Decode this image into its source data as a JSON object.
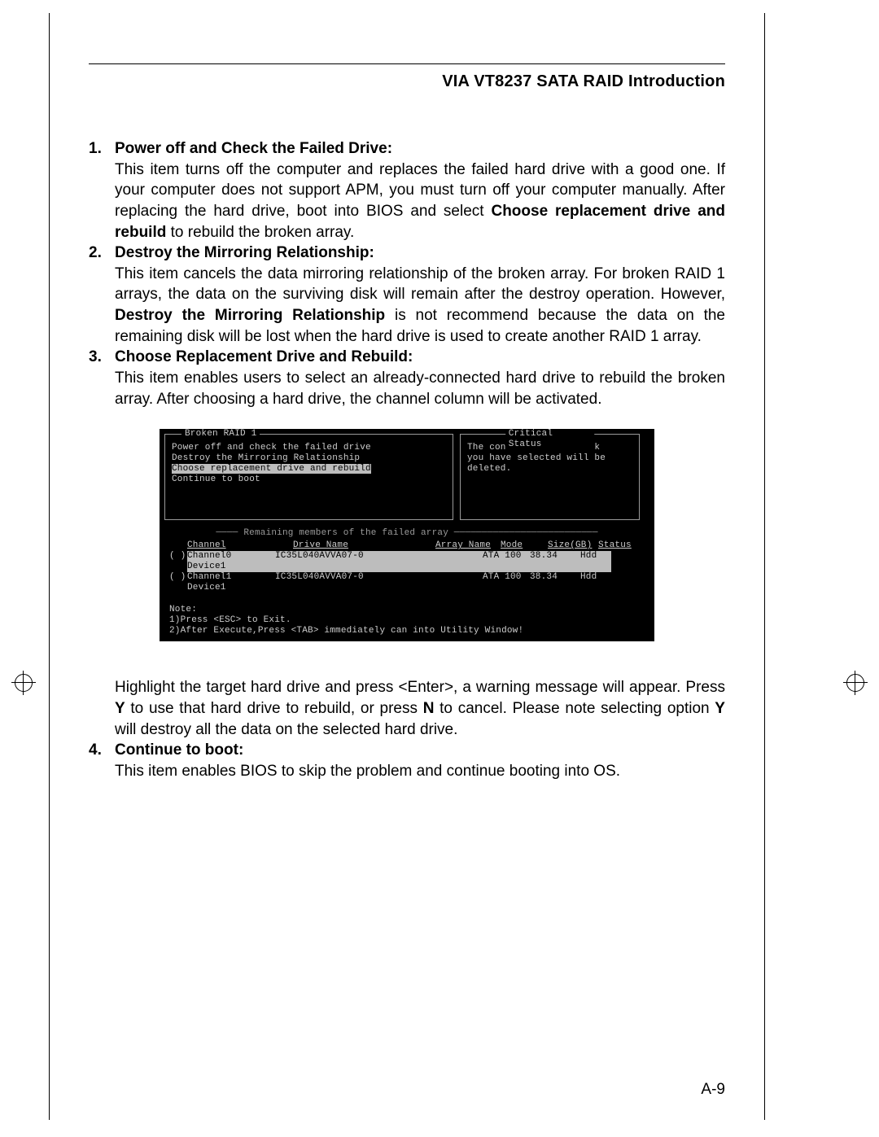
{
  "header": {
    "title": "VIA VT8237 SATA RAID Introduction"
  },
  "items": [
    {
      "num": "1.",
      "title": "Power off and Check the Failed Drive:",
      "body_pre": "This item turns off the computer and replaces the failed hard drive with a good one. If your computer does not support APM, you must turn off your computer manually. After replacing the hard drive, boot into BIOS and select ",
      "body_bold": "Choose replacement drive and rebuild",
      "body_post": " to rebuild the broken array."
    },
    {
      "num": "2.",
      "title": "Destroy the Mirroring Relationship:",
      "body_pre": "This item cancels the data mirroring relationship of the broken array.  For broken RAID 1 arrays, the data on the surviving disk will remain after the destroy operation. However, ",
      "body_bold": "Destroy the Mirroring Relationship",
      "body_post": " is not recommend because the data on the remaining disk will be lost when the hard drive is used to create another RAID 1 array."
    },
    {
      "num": "3.",
      "title": "Choose Replacement Drive and Rebuild:",
      "body_pre": "This item enables users to select an already-connected hard drive to rebuild the broken array.  After choosing a hard drive, the channel column will be activated.",
      "body_bold": "",
      "body_post": ""
    }
  ],
  "post_bios": {
    "pre": "Highlight the target hard drive and press <Enter>, a warning message will appear. Press ",
    "y": "Y",
    "mid": " to use that hard drive to rebuild, or press ",
    "n": "N",
    "mid2": " to cancel.  Please note selecting option ",
    "y2": "Y",
    "post": " will destroy all the data on the selected hard drive."
  },
  "item4": {
    "num": "4.",
    "title": "Continue to boot:",
    "body": "This item enables BIOS to skip the problem and continue booting into OS."
  },
  "bios": {
    "left_title": "Broken RAID 1",
    "right_title": "Critical Status",
    "menu": [
      "Power off and check the failed drive",
      "Destroy the Mirroring Relationship",
      "Choose replacement drive and rebuild",
      "Continue to boot"
    ],
    "status": [
      "The contents on the disk",
      "you have selected will be",
      "deleted."
    ],
    "sep_label": "Remaining members of the failed array",
    "headers": {
      "channel": "Channel",
      "drive": "Drive Name",
      "array": "Array Name",
      "mode": "Mode",
      "size": "Size(GB)",
      "status": "Status"
    },
    "rows": [
      {
        "paren": "( )",
        "channel": "Channel0 Device1",
        "drive": "IC35L040AVVA07-0",
        "array": "",
        "mode": "ATA 100",
        "size": "38.34",
        "status": "Hdd",
        "highlight": true
      },
      {
        "paren": "( )",
        "channel": "Channel1 Device1",
        "drive": "IC35L040AVVA07-0",
        "array": "",
        "mode": "ATA 100",
        "size": "38.34",
        "status": "Hdd",
        "highlight": false
      }
    ],
    "note": [
      "Note:",
      "1)Press <ESC> to Exit.",
      "2)After Execute,Press <TAB> immediately can into Utility Window!"
    ]
  },
  "footer": {
    "page": "A-9"
  }
}
